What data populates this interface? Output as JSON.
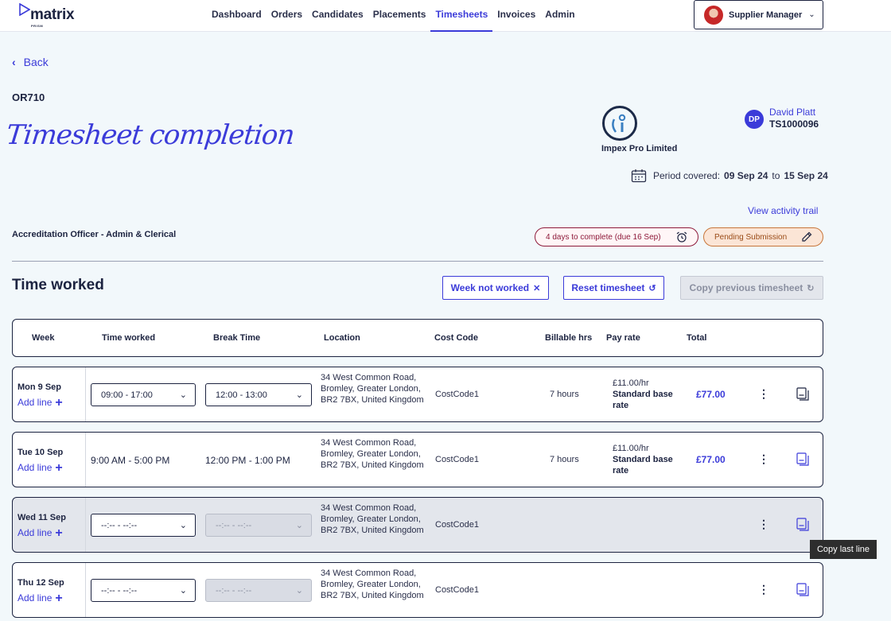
{
  "brand": {
    "name": "matrix",
    "sub": "PRISM"
  },
  "nav": [
    "Dashboard",
    "Orders",
    "Candidates",
    "Placements",
    "Timesheets",
    "Invoices",
    "Admin"
  ],
  "nav_active": "Timesheets",
  "user_menu": {
    "label": "Supplier Manager"
  },
  "back_label": "Back",
  "order_id": "OR710",
  "page_title": "Timesheet completion",
  "company": {
    "name": "Impex Pro Limited"
  },
  "worker": {
    "initials": "DP",
    "name": "David Platt",
    "id": "TS1000096"
  },
  "period": {
    "label": "Period covered:",
    "from": "09 Sep 24",
    "to_word": "to",
    "to": "15 Sep 24"
  },
  "activity_link": "View activity trail",
  "job_title": "Accreditation Officer - Admin & Clerical",
  "badges": {
    "due": "4 days to complete (due 16 Sep)",
    "status": "Pending Submission"
  },
  "section_title": "Time worked",
  "buttons": {
    "week_not_worked": "Week not worked",
    "reset": "Reset timesheet",
    "copy_previous": "Copy previous timesheet"
  },
  "table": {
    "headers": [
      "Week",
      "Time worked",
      "Break Time",
      "Location",
      "Cost Code",
      "Billable hrs",
      "Pay rate",
      "Total"
    ],
    "add_line": "Add line",
    "rows": [
      {
        "day": "Mon 9 Sep",
        "time": "09:00 - 17:00",
        "break": "12:00 - 13:00",
        "location": "34 West Common Road, Bromley, Greater London, BR2 7BX, United Kingdom",
        "cost_code": "CostCode1",
        "hours": "7 hours",
        "rate": "£11.00/hr",
        "rate_type": "Standard base rate",
        "total": "£77.00"
      },
      {
        "day": "Tue 10 Sep",
        "time": "9:00 AM - 5:00 PM",
        "break": "12:00 PM - 1:00 PM",
        "location": "34 West Common Road, Bromley, Greater London, BR2 7BX, United Kingdom",
        "cost_code": "CostCode1",
        "hours": "7 hours",
        "rate": "£11.00/hr",
        "rate_type": "Standard base rate",
        "total": "£77.00"
      },
      {
        "day": "Wed 11 Sep",
        "time": "--:-- - --:--",
        "break": "--:-- - --:--",
        "location": "34 West Common Road, Bromley, Greater London, BR2 7BX, United Kingdom",
        "cost_code": "CostCode1"
      },
      {
        "day": "Thu 12 Sep",
        "time": "--:-- - --:--",
        "break": "--:-- - --:--",
        "location": "34 West Common Road, Bromley, Greater London, BR2 7BX, United Kingdom",
        "cost_code": "CostCode1"
      }
    ]
  },
  "tooltip": "Copy last line",
  "colors": {
    "accent": "#3b3bd9",
    "navy": "#1c2340",
    "background": "#f2f8fb",
    "due_badge": "#8e1a3a",
    "pending_badge": "#fbe5d6"
  }
}
